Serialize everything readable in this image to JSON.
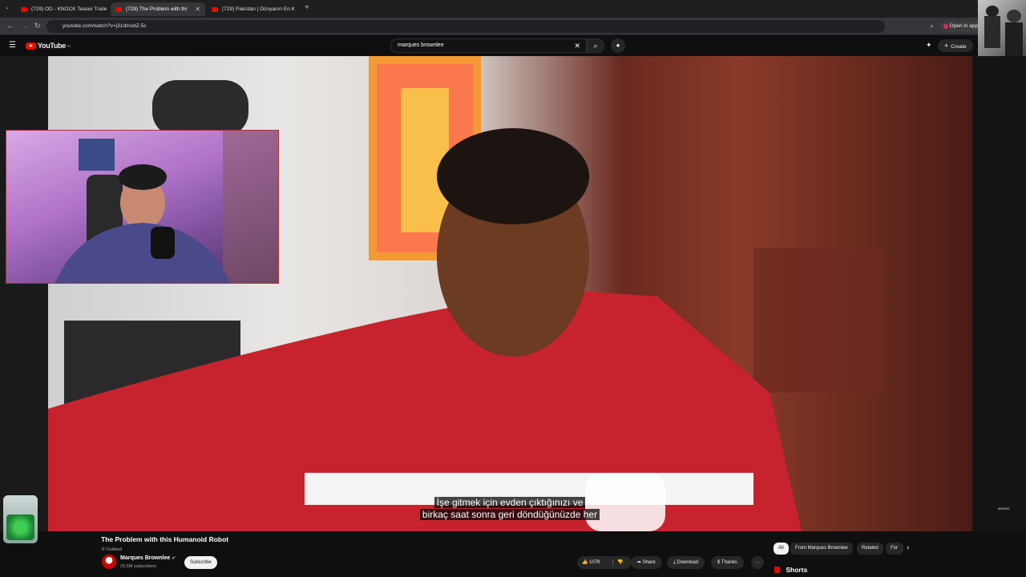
{
  "browser": {
    "tabs": [
      {
        "label": "(729) OD - KNOCK Teaser Traile",
        "active": false
      },
      {
        "label": "(729) The Problem with thi",
        "active": true
      },
      {
        "label": "(729) Pakistan | Dünyanın En K",
        "active": false
      }
    ],
    "url": "youtube.com/watch?v=j31dmodZ-5c",
    "open_in_app": "Open in app"
  },
  "header": {
    "logo_text": "YouTube",
    "logo_country": "TR",
    "search_value": "marques brownlee",
    "create_label": "Create"
  },
  "video": {
    "subtitle_line1": "İşe gitmek için evden çıktığınızı ve",
    "subtitle_line2": "birkaç saat sonra geri döndüğünüzde her",
    "watermark": "MKBHD"
  },
  "info": {
    "title": "The Problem with this Humanoid Robot",
    "dubbed": "Dubbed",
    "channel": "Marques Brownlee",
    "subscribers": "20.5M subscribers",
    "subscribe_label": "Subscribe",
    "likes": "107K",
    "share_label": "Share",
    "download_label": "Download",
    "thanks_label": "Thanks",
    "more_label": "···"
  },
  "sidebar": {
    "chips": [
      "All",
      "From Marques Brownlee",
      "Related",
      "For"
    ],
    "shorts_label": "Shorts"
  }
}
